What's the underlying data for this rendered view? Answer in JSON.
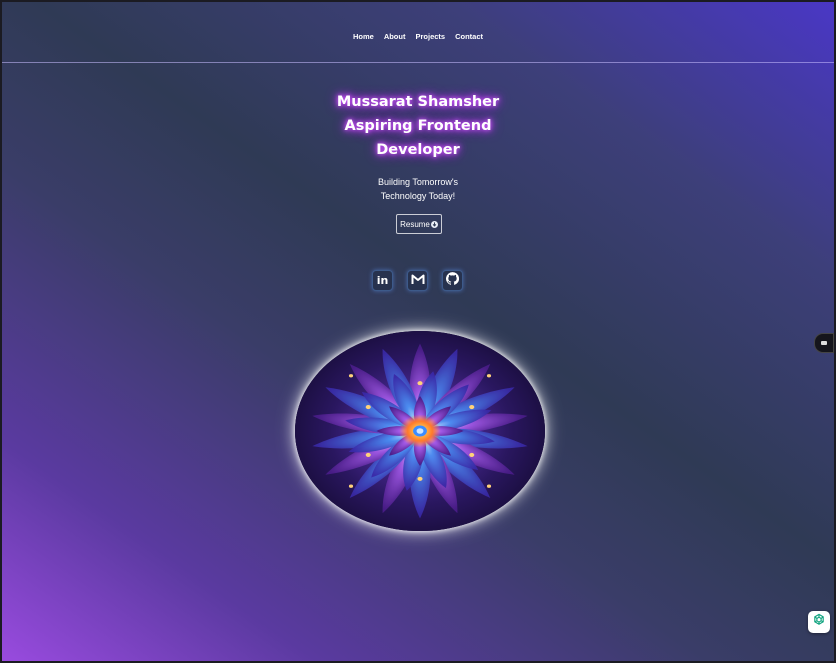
{
  "nav": {
    "items": [
      {
        "label": "Home"
      },
      {
        "label": "About"
      },
      {
        "label": "Projects"
      },
      {
        "label": "Contact"
      }
    ]
  },
  "hero": {
    "title_lines": [
      "Mussarat Shamsher",
      "Aspiring Frontend",
      "Developer"
    ],
    "tagline_lines": [
      "Building Tomorrow's",
      "Technology Today!"
    ],
    "resume_label": "Resume"
  },
  "socials": [
    {
      "icon": "linkedin-icon",
      "glyph": "in"
    },
    {
      "icon": "gmail-icon"
    },
    {
      "icon": "github-icon"
    }
  ],
  "colors": {
    "accent_glow": "#c03cf5",
    "bg_top_right": "#4a37c7",
    "bg_bottom_left": "#9a4be0"
  }
}
